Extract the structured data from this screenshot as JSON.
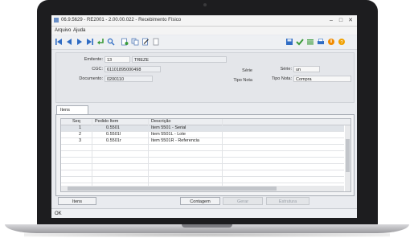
{
  "window": {
    "title": "06.9.5629 - RE2001 - 2.00.00.022 - Recebimento Físico"
  },
  "menu": {
    "items": [
      "Arquivo",
      "Ajuda"
    ]
  },
  "toolbar": {
    "left_icons": [
      "first-icon",
      "prev-icon",
      "next-icon",
      "last-icon",
      "goto-icon",
      "search-icon",
      "new-icon",
      "copy-icon",
      "edit-icon",
      "delete-icon"
    ],
    "right_icons": [
      "save-icon",
      "confirm-icon",
      "list-icon",
      "print-icon",
      "exit-icon",
      "help-icon"
    ]
  },
  "header": {
    "emitente_label": "Emitente:",
    "emitente_code": "13",
    "emitente_name": "TREZE",
    "cgc_label": "CGC:",
    "cgc_value": "61101895000498",
    "serie_label_ro": "Série",
    "serie_label": "Série:",
    "serie_value": "un",
    "documento_label": "Documento:",
    "documento_value": "0200110",
    "tipo_nota_label_ro": "Tipo Nota",
    "tipo_nota_label": "Tipo Nota:",
    "tipo_nota_value": "Compra"
  },
  "tabs": [
    {
      "label": "Itens"
    }
  ],
  "grid": {
    "columns": [
      "Seq",
      "Pedido Item",
      "Descrição"
    ],
    "rows": [
      {
        "seq": "1",
        "item": "0.5501",
        "descricao": "Item 5501 - Serial"
      },
      {
        "seq": "2",
        "item": "0.5501l",
        "descricao": "Item 5501L - Lote"
      },
      {
        "seq": "3",
        "item": "0.5501r",
        "descricao": "Item 5501R - Referencia"
      }
    ],
    "selected_row": 1
  },
  "buttons": {
    "itens": "Itens",
    "contagem": "Contagem",
    "gerar": "Gerar",
    "estrutura": "Estrutura"
  },
  "status": {
    "text": "OK"
  },
  "colors": {
    "accent": "#2f6cc4",
    "confirm": "#3a9b3a",
    "exit": "#f08a00",
    "help": "#f0a000"
  }
}
